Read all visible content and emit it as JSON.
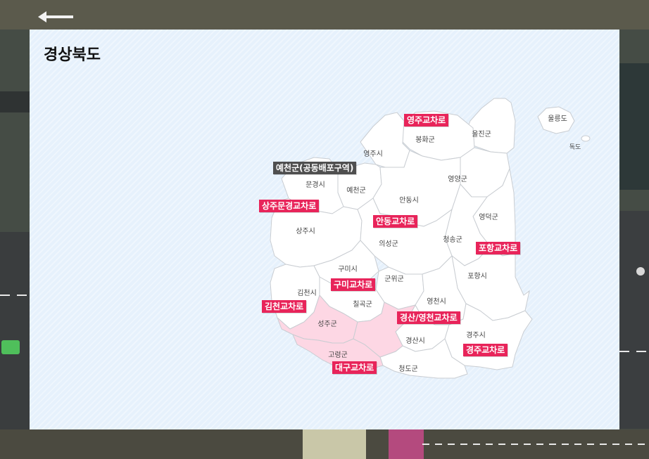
{
  "panel": {
    "title": "경상북도"
  },
  "colors": {
    "panel_bg": "#e6f1fc",
    "region_fill": "#ffffff",
    "region_border": "#c9cdd2",
    "daegu_fill": "#fdd7e4",
    "interchange_tag": "#e8245a",
    "joint_area_tag": "#4f4f4f"
  },
  "icons": {
    "back": "arrow-left-icon"
  },
  "regions": {
    "uljin": "울진군",
    "bonghwa": "봉화군",
    "yeongju": "영주시",
    "yeongyang": "영양군",
    "yecheon": "예천군",
    "mungyeong": "문경시",
    "andong": "안동시",
    "yeongdeok": "영덕군",
    "sangju": "상주시",
    "cheongsong": "청송군",
    "uiseong": "의성군",
    "gumi": "구미시",
    "gunwi": "군위군",
    "pohang": "포항시",
    "gimcheon": "김천시",
    "yeongcheon": "영천시",
    "chilgok": "칠곡군",
    "seongju": "성주군",
    "gyeongsan": "경산시",
    "gyeongju": "경주시",
    "goryeong": "고령군",
    "cheongdo": "청도군",
    "ulleung": "울릉도",
    "dokdo": "독도"
  },
  "tags": {
    "yeongju": "영주교차로",
    "yecheon_joint": "예천군(공동배포구역)",
    "sangju": "상주문경교차로",
    "andong": "안동교차로",
    "pohang": "포항교차로",
    "gumi": "구미교차로",
    "gimcheon": "김천교차로",
    "gyeongsan": "경산/영천교차로",
    "gyeongju": "경주교차로",
    "daegu": "대구교차로"
  }
}
